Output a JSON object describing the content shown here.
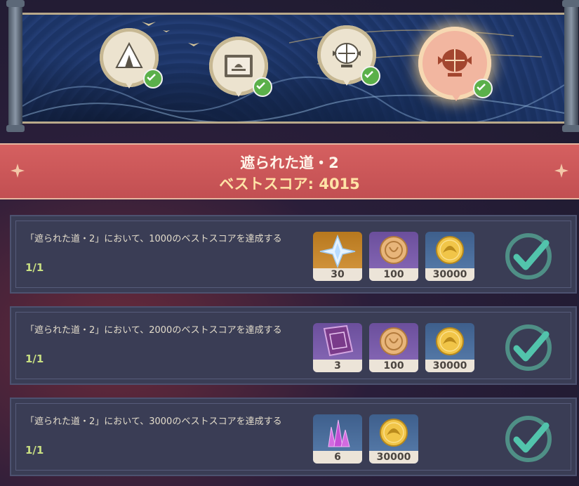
{
  "stages": [
    {
      "icon": "camp-tent-icon",
      "completed": true
    },
    {
      "icon": "cake-stand-icon",
      "completed": true
    },
    {
      "icon": "lantern-icon",
      "completed": true
    },
    {
      "icon": "lantern-active-icon",
      "completed": true,
      "active": true
    }
  ],
  "title": "遮られた道・2",
  "best_score": "ベストスコア: 4015",
  "tasks": [
    {
      "description": "「遮られた道・2」において、1000のベストスコアを達成する",
      "progress": "1/1",
      "rewards": [
        {
          "icon": "primogem-icon",
          "count": "30"
        },
        {
          "icon": "festival-coin-icon",
          "count": "100"
        },
        {
          "icon": "mora-icon",
          "count": "30000"
        }
      ],
      "completed": true
    },
    {
      "description": "「遮られた道・2」において、2000のベストスコアを達成する",
      "progress": "1/1",
      "rewards": [
        {
          "icon": "book-icon",
          "count": "3"
        },
        {
          "icon": "festival-coin-icon",
          "count": "100"
        },
        {
          "icon": "mora-icon",
          "count": "30000"
        }
      ],
      "completed": true
    },
    {
      "description": "「遮られた道・2」において、3000のベストスコアを達成する",
      "progress": "1/1",
      "rewards": [
        {
          "icon": "crystal-icon",
          "count": "6"
        },
        {
          "icon": "mora-icon",
          "count": "30000"
        }
      ],
      "completed": true
    }
  ]
}
